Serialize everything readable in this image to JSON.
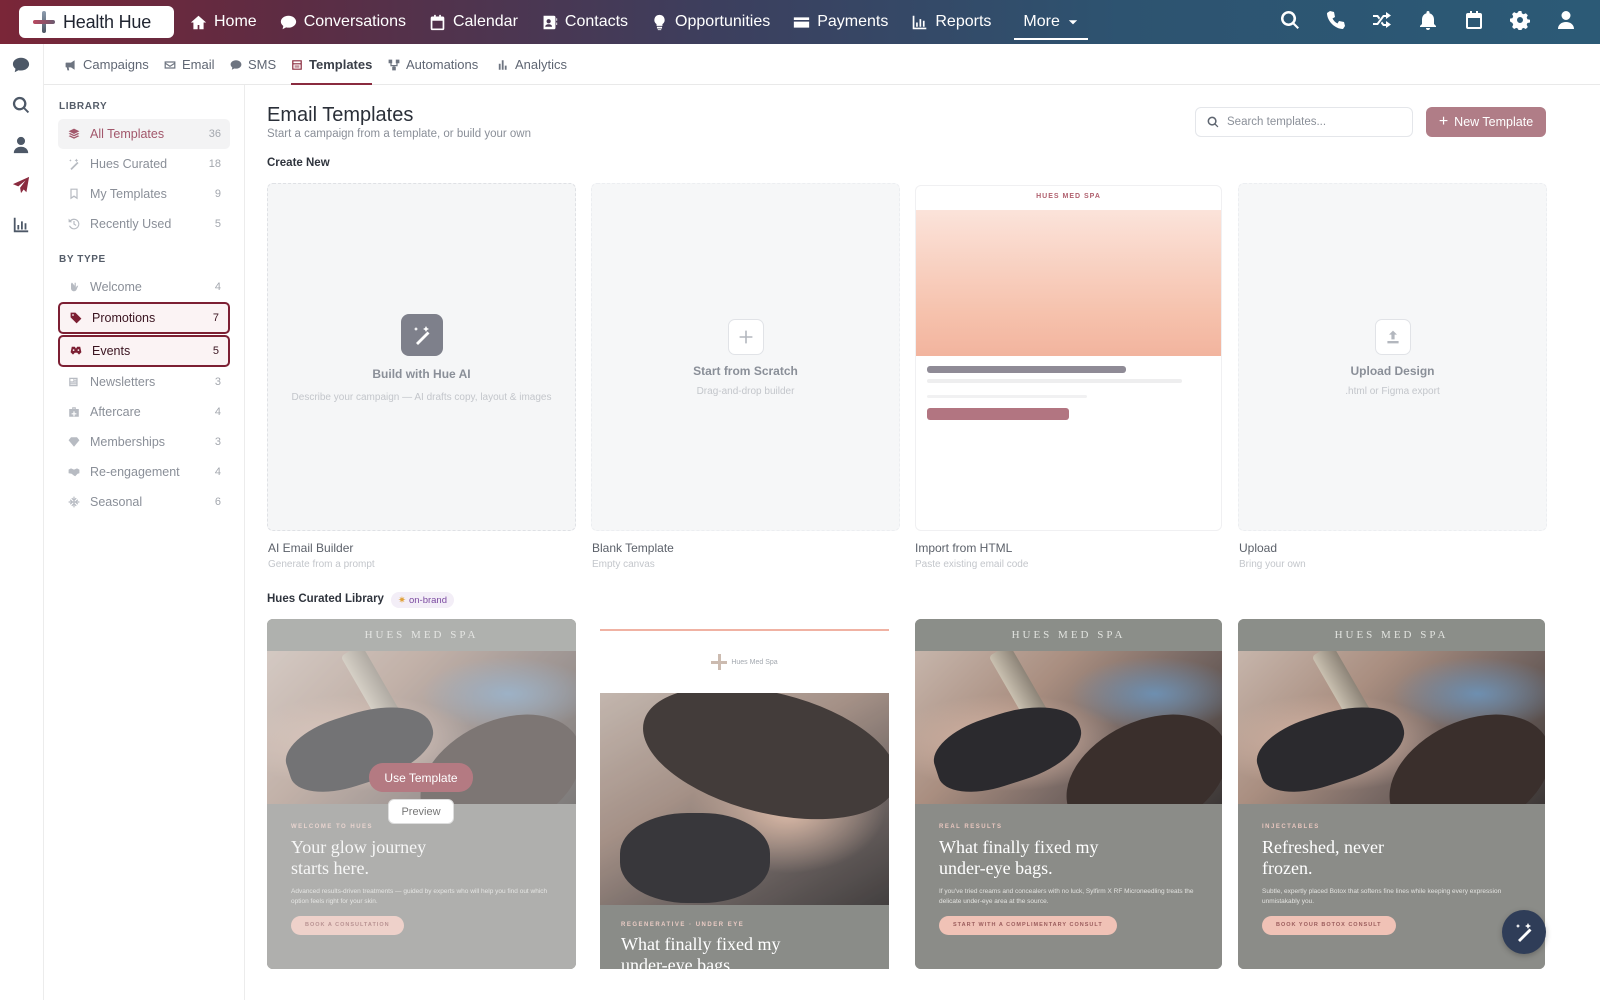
{
  "app": {
    "brand": "Health Hue"
  },
  "nav": {
    "items": [
      {
        "label": "Home",
        "icon": "home-icon"
      },
      {
        "label": "Conversations",
        "icon": "chat-icon"
      },
      {
        "label": "Calendar",
        "icon": "calendar-icon"
      },
      {
        "label": "Contacts",
        "icon": "contacts-icon"
      },
      {
        "label": "Opportunities",
        "icon": "lightbulb-icon"
      },
      {
        "label": "Payments",
        "icon": "card-icon"
      },
      {
        "label": "Reports",
        "icon": "chart-icon"
      }
    ],
    "more_label": "More",
    "right_icons": [
      "search-icon",
      "phone-icon",
      "shuffle-icon",
      "bell-icon",
      "calendar-icon",
      "gear-icon",
      "user-icon"
    ]
  },
  "rail": {
    "icons": [
      "chat-icon",
      "search-icon",
      "user-icon",
      "send-icon",
      "chart-icon"
    ]
  },
  "subnav": {
    "tabs": [
      {
        "label": "Campaigns",
        "icon": "megaphone-icon"
      },
      {
        "label": "Email",
        "icon": "envelope-icon"
      },
      {
        "label": "SMS",
        "icon": "sms-icon"
      },
      {
        "label": "Templates",
        "icon": "template-icon",
        "active": true
      },
      {
        "label": "Automations",
        "icon": "workflow-icon"
      },
      {
        "label": "Analytics",
        "icon": "bar-chart-icon"
      }
    ]
  },
  "sidebar": {
    "library_heading": "LIBRARY",
    "library": [
      {
        "label": "All Templates",
        "count": "36",
        "icon": "layers-icon"
      },
      {
        "label": "Hues Curated",
        "count": "18",
        "icon": "magic-wand-icon"
      },
      {
        "label": "My Templates",
        "count": "9",
        "icon": "bookmark-icon"
      },
      {
        "label": "Recently Used",
        "count": "5",
        "icon": "history-icon"
      }
    ],
    "type_heading": "BY TYPE",
    "types": [
      {
        "label": "Welcome",
        "count": "4",
        "icon": "wave-hand-icon"
      },
      {
        "label": "Promotions",
        "count": "7",
        "icon": "tag-icon"
      },
      {
        "label": "Events",
        "count": "5",
        "icon": "event-icon"
      },
      {
        "label": "Newsletters",
        "count": "3",
        "icon": "newspaper-icon"
      },
      {
        "label": "Aftercare",
        "count": "4",
        "icon": "medkit-icon"
      },
      {
        "label": "Memberships",
        "count": "3",
        "icon": "gem-icon"
      },
      {
        "label": "Re-engagement",
        "count": "4",
        "icon": "handshake-icon"
      },
      {
        "label": "Seasonal",
        "count": "6",
        "icon": "snowflake-icon"
      }
    ]
  },
  "main": {
    "title": "Email Templates",
    "subtitle": "Start a campaign from a template, or build your own",
    "search_placeholder": "Search templates...",
    "new_button": "New Template",
    "create_heading": "Create New",
    "create_cards": [
      {
        "title": "Build with Hue AI",
        "desc": "Describe your campaign — AI drafts copy, layout & images",
        "label": "AI Email Builder",
        "sub": "Generate from a prompt"
      },
      {
        "title": "Start from Scratch",
        "desc": "Drag-and-drop builder",
        "label": "Blank Template",
        "sub": "Empty canvas"
      },
      {
        "brand": "HUES MED SPA",
        "label": "Import from HTML",
        "sub": "Paste existing email code"
      },
      {
        "title": "Upload Design",
        "desc": ".html or Figma export",
        "label": "Upload",
        "sub": "Bring your own"
      }
    ],
    "curated_heading": "Hues Curated Library",
    "curated_badge": "on-brand",
    "templates": [
      {
        "brand": "HUES MED SPA",
        "eyebrow": "WELCOME TO HUES",
        "headline": "Your glow journey starts here.",
        "copy": "Advanced results-driven treatments — guided by experts who will help you find out which option feels right for your skin.",
        "cta": "BOOK A CONSULTATION",
        "use_label": "Use Template",
        "preview_label": "Preview"
      },
      {
        "brand": "Hues Med Spa",
        "eyebrow": "REGENERATIVE · UNDER EYE",
        "headline": "What finally fixed my under-eye bags"
      },
      {
        "brand": "HUES MED SPA",
        "eyebrow": "REAL RESULTS",
        "headline": "What finally fixed my under-eye bags.",
        "copy": "If you've tried creams and concealers with no luck, Sylfirm X RF Microneedling treats the delicate under-eye area at the source.",
        "cta": "START WITH A COMPLIMENTARY CONSULT"
      },
      {
        "brand": "HUES MED SPA",
        "eyebrow": "INJECTABLES",
        "headline": "Refreshed, never frozen.",
        "copy": "Subtle, expertly placed Botox that softens fine lines while keeping every expression unmistakably you.",
        "cta": "BOOK YOUR BOTOX CONSULT"
      }
    ]
  },
  "fab_icon": "magic-wand-icon",
  "colors": {
    "accent": "#8a2b3f",
    "primary_button": "#b07d87",
    "highlight_border": "#7c1f33"
  }
}
